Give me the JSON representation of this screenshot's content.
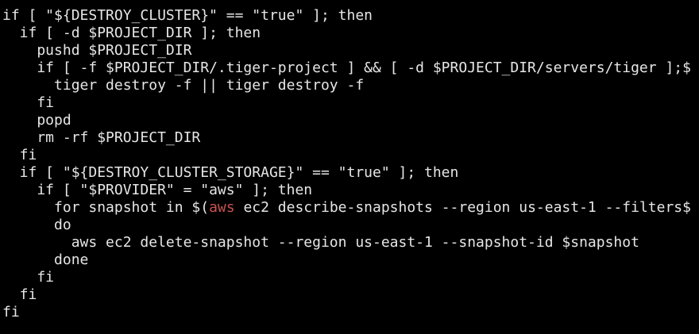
{
  "terminal": {
    "text_color": "#e6e6e6",
    "background": "#000000",
    "highlight_color": "#c9534f",
    "lines": [
      "if [ \"${DESTROY_CLUSTER}\" == \"true\" ]; then",
      "  if [ -d $PROJECT_DIR ]; then",
      "    pushd $PROJECT_DIR",
      "    if [ -f $PROJECT_DIR/.tiger-project ] && [ -d $PROJECT_DIR/servers/tiger ];$",
      "      tiger destroy -f || tiger destroy -f",
      "    fi",
      "    popd",
      "    rm -rf $PROJECT_DIR",
      "  fi",
      "  if [ \"${DESTROY_CLUSTER_STORAGE}\" == \"true\" ]; then",
      "    if [ \"$PROVIDER\" = \"aws\" ]; then",
      "      for snapshot in $(",
      "aws",
      " ec2 describe-snapshots --region us-east-1 --filters$",
      "      do",
      "        aws ec2 delete-snapshot --region us-east-1 --snapshot-id $snapshot",
      "      done",
      "    fi",
      "  fi",
      "fi"
    ]
  }
}
